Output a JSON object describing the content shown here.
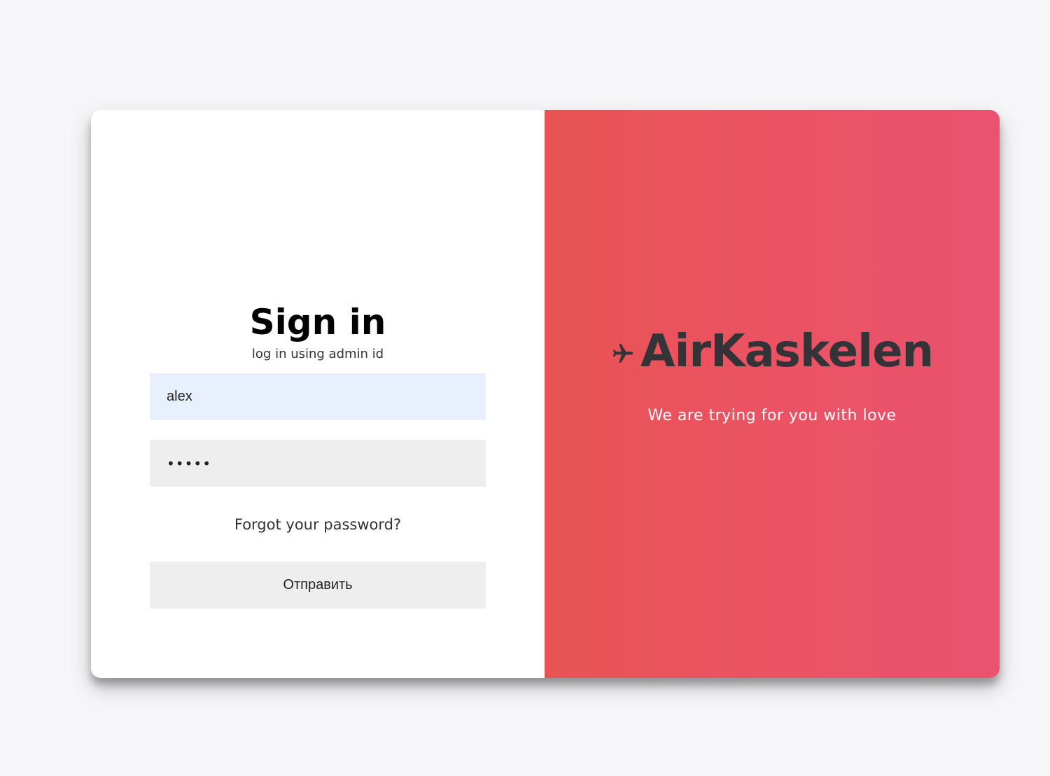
{
  "login": {
    "title": "Sign in",
    "subtitle": "log in using admin id",
    "username_value": "alex",
    "password_value": "•••••",
    "forgot_link": "Forgot your password?",
    "submit_label": "Отправить"
  },
  "brand": {
    "icon": "airplane-icon",
    "name": "AirKaskelen",
    "tagline": "We are trying for you with love"
  },
  "colors": {
    "page_background": "#f6f6f8",
    "accent_gradient_start": "#e85353",
    "accent_gradient_end": "#ea526f",
    "input_autofill": "#e8f0fe",
    "input_background": "#eeeeee",
    "brand_text": "#333338"
  }
}
